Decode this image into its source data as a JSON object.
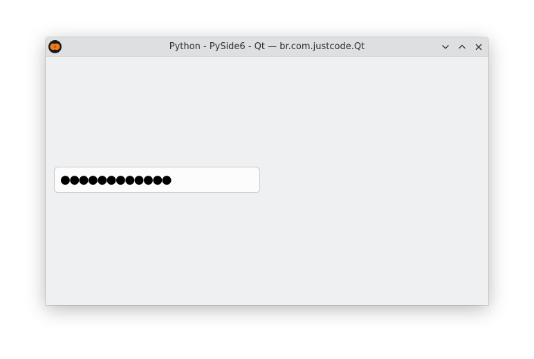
{
  "window": {
    "title": "Python - PySide6 - Qt — br.com.justcode.Qt",
    "app_icon": "orange-circles-icon",
    "controls": {
      "minimize_icon": "chevron-down-icon",
      "maximize_icon": "chevron-up-icon",
      "close_icon": "close-icon"
    }
  },
  "password_field": {
    "masked_value": "●●●●●●●●●●●●"
  },
  "colors": {
    "titlebar_bg": "#dedfe1",
    "window_bg": "#eff0f1",
    "field_bg": "#fcfcfc",
    "icon_orange": "#e8771a"
  }
}
